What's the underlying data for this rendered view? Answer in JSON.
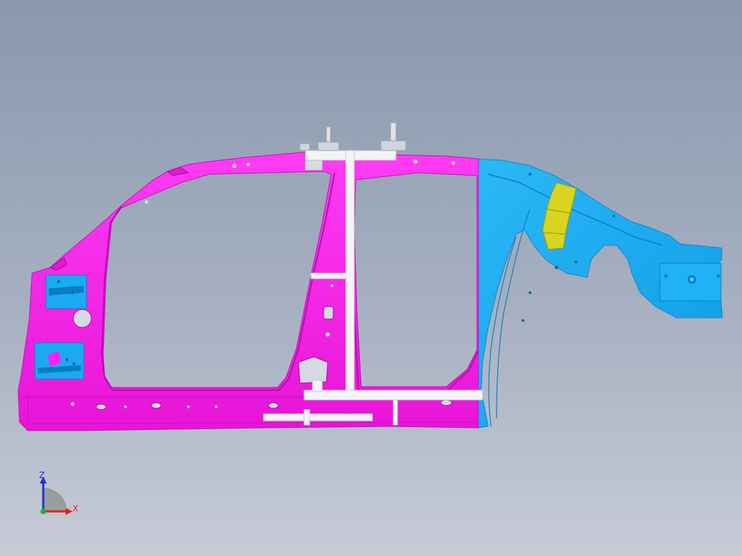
{
  "viewport": {
    "model": "body side panel",
    "colors": {
      "front_panel": "#ff22f0",
      "rear_panel": "#18aaf0",
      "reinforcement": "#d6d21a",
      "fixture": "#f4f4f6",
      "fixture_shadow": "#b8bcc6",
      "background_top": "#8a98ad",
      "background_bottom": "#c6cbd6"
    }
  },
  "triad": {
    "z_label": "Z",
    "x_label": "X",
    "colors": {
      "z": "#2030d0",
      "x": "#e02020",
      "y": "#20b040",
      "arc": "#7a7a7a"
    }
  }
}
